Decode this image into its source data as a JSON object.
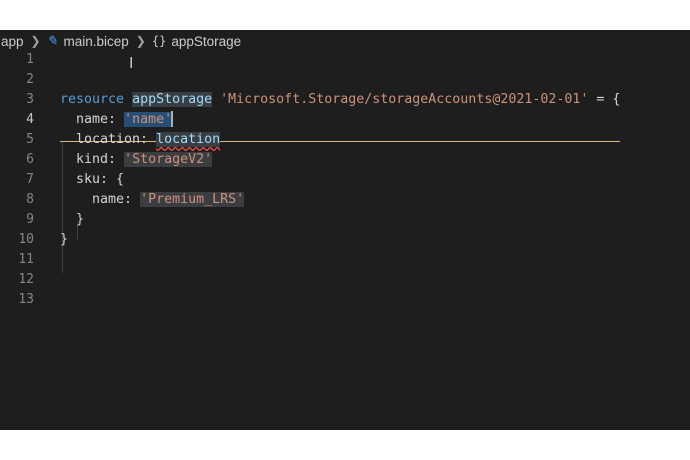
{
  "breadcrumb": {
    "folder": "app",
    "file": "main.bicep",
    "symbol_icon": "{}",
    "symbol": "appStorage",
    "separator": ">"
  },
  "icons": {
    "file_icon": "bicep-file-icon",
    "symbol_icon": "module-symbol-icon",
    "text_cursor": "i-beam-cursor-icon"
  },
  "colors": {
    "editor_background": "#1e1e1e",
    "keyword": "#569cd6",
    "identifier": "#9cdcfe",
    "string": "#ce9178",
    "selection": "#264f78",
    "error_squiggle": "#f14c4c"
  },
  "gutter": {
    "line_numbers": [
      "1",
      "2",
      "3",
      "4",
      "5",
      "6",
      "7",
      "8",
      "9",
      "10",
      "11",
      "12",
      "13"
    ],
    "active_line": "4"
  },
  "code": {
    "l3": {
      "keyword": "resource",
      "name": "appStorage",
      "type": "'Microsoft.Storage/storageAccounts@2021-02-01'",
      "tail": " = {"
    },
    "l4": {
      "prop": "name: ",
      "value": "'name'"
    },
    "l5": {
      "prop": "location: ",
      "value": "location"
    },
    "l6": {
      "prop": "kind: ",
      "value": "'StorageV2'"
    },
    "l7": {
      "prop": "sku: {"
    },
    "l8": {
      "prop": "name: ",
      "value": "'Premium_LRS'"
    },
    "l9": {
      "text": "}"
    },
    "l10": {
      "text": "}"
    }
  }
}
